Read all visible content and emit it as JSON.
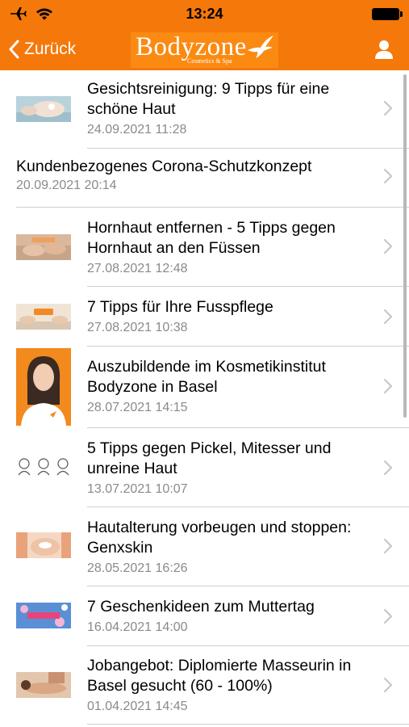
{
  "status_bar": {
    "time": "13:24",
    "icons": [
      "airplane-icon",
      "wifi-icon",
      "battery-icon"
    ]
  },
  "nav_bar": {
    "back_label": "Zurück",
    "logo_text": "Bodyzone",
    "logo_subtitle": "Cosmetics & Spa",
    "profile_icon": "person-icon"
  },
  "colors": {
    "brand_orange": "#f5780a",
    "chevron": "#c7c7cc",
    "date_gray": "#8a8a8a"
  },
  "articles": [
    {
      "title": "Gesichtsreinigung: 9 Tipps für eine schöne Haut",
      "date": "24.09.2021 11:28",
      "thumbnail": "face-cleansing-photo"
    },
    {
      "title": "Kundenbezogenes Corona-Schutzkonzept",
      "date": "20.09.2021 20:14",
      "thumbnail": ""
    },
    {
      "title": "Hornhaut entfernen - 5 Tipps gegen Hornhaut an den Füssen",
      "date": "27.08.2021 12:48",
      "thumbnail": "feet-photo"
    },
    {
      "title": "7 Tipps für Ihre Fusspflege",
      "date": "27.08.2021 10:38",
      "thumbnail": "foot-care-photo"
    },
    {
      "title": "Auszubildende im Kosmetikinstitut Bodyzone in Basel",
      "date": "28.07.2021 14:15",
      "thumbnail": "portrait-photo"
    },
    {
      "title": "5 Tipps gegen Pickel, Mitesser und unreine Haut",
      "date": "13.07.2021 10:07",
      "thumbnail": "face-illustrations"
    },
    {
      "title": "Hautalterung vorbeugen und stoppen: Genxskin",
      "date": "28.05.2021 16:26",
      "thumbnail": "facial-treatment-photo"
    },
    {
      "title": "7 Geschenkideen zum Muttertag",
      "date": "16.04.2021 14:00",
      "thumbnail": "mothers-day-banner"
    },
    {
      "title": "Jobangebot: Diplomierte Masseurin in Basel gesucht (60 - 100%)",
      "date": "01.04.2021 14:45",
      "thumbnail": "massage-photo"
    }
  ]
}
